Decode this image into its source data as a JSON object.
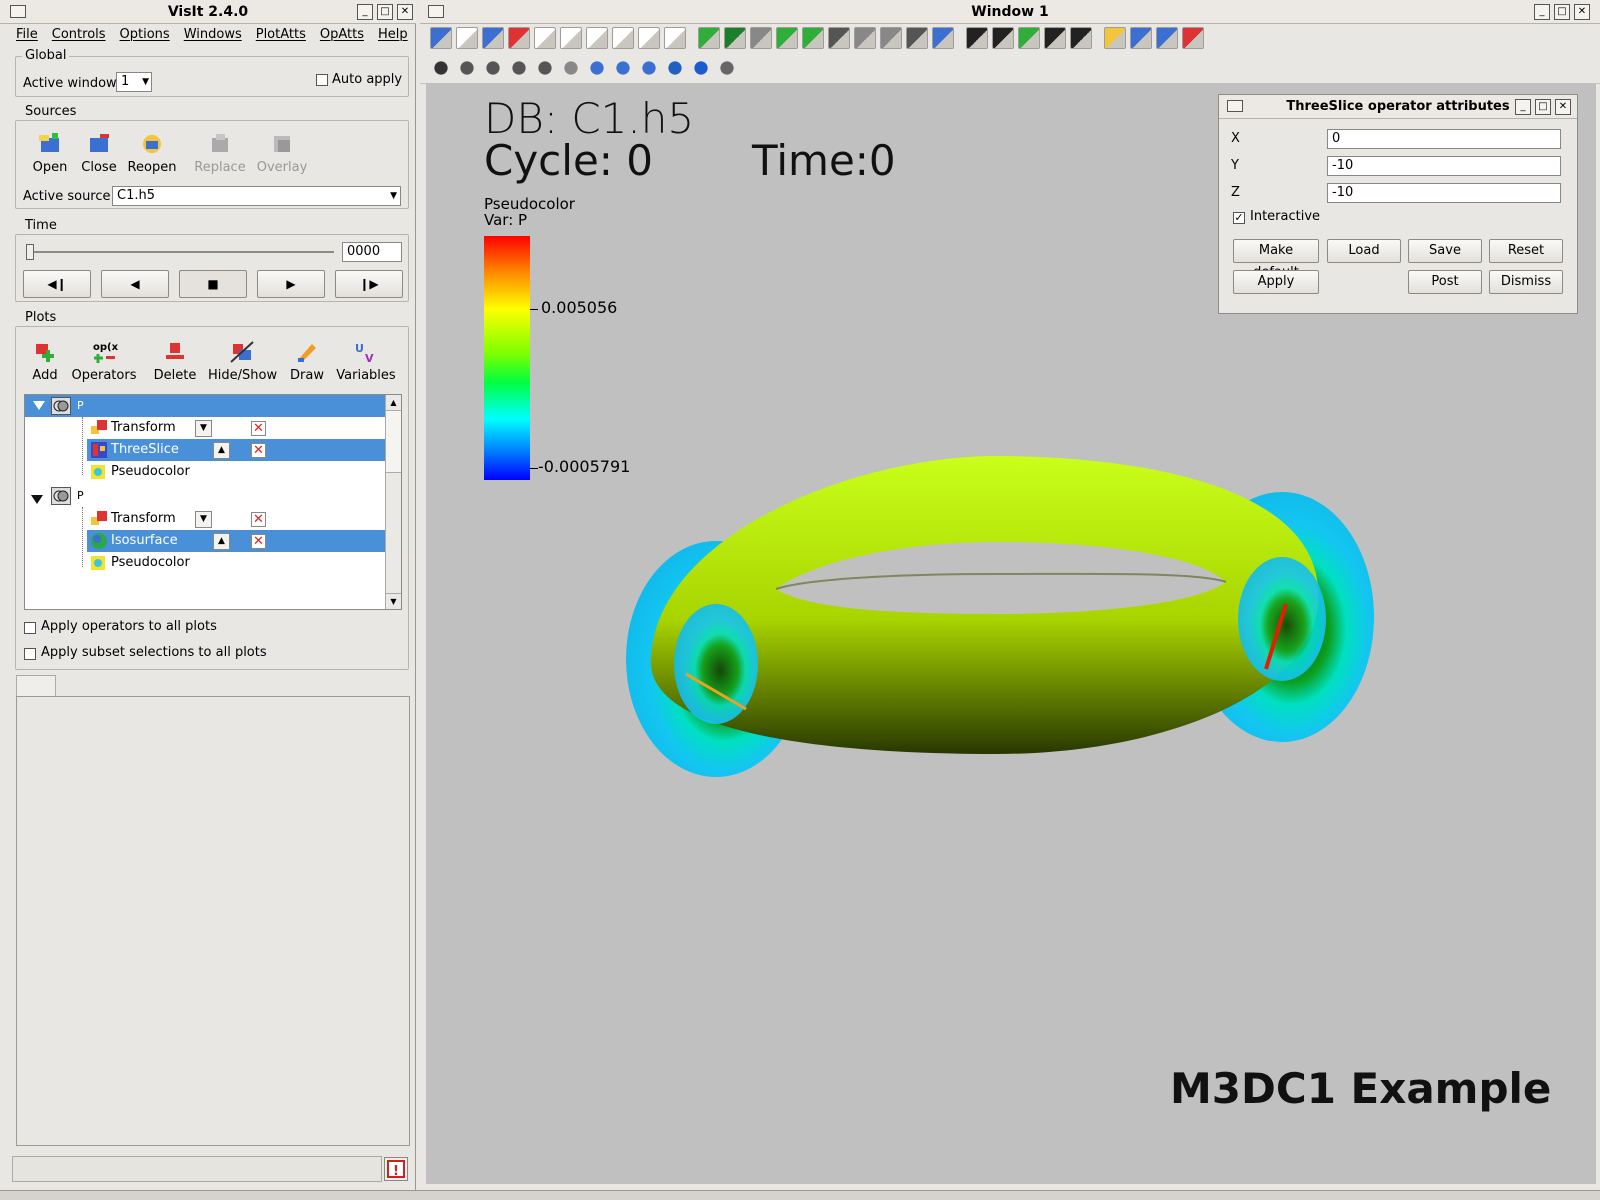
{
  "gui": {
    "title": "VisIt 2.4.0",
    "menu": [
      "File",
      "Controls",
      "Options",
      "Windows",
      "PlotAtts",
      "OpAtts",
      "Help"
    ],
    "global": {
      "title": "Global",
      "active_window_label": "Active window",
      "active_window_value": "1",
      "auto_apply_label": "Auto apply"
    },
    "sources": {
      "title": "Sources",
      "buttons": [
        "Open",
        "Close",
        "Reopen",
        "Replace",
        "Overlay"
      ],
      "active_source_label": "Active source",
      "active_source_value": "C1.h5"
    },
    "time": {
      "title": "Time",
      "frame_value": "0000"
    },
    "plots": {
      "title": "Plots",
      "buttons": [
        "Add",
        "Operators",
        "Delete",
        "Hide/Show",
        "Draw",
        "Variables"
      ],
      "tree": [
        {
          "label": "P"
        },
        {
          "label": "Transform"
        },
        {
          "label": "ThreeSlice"
        },
        {
          "label": "Pseudocolor"
        },
        {
          "label": "P"
        },
        {
          "label": "Transform"
        },
        {
          "label": "Isosurface"
        },
        {
          "label": "Pseudocolor"
        }
      ],
      "apply_ops_label": "Apply operators to all plots",
      "apply_subset_label": "Apply subset selections to all plots"
    }
  },
  "viewer": {
    "title": "Window 1",
    "db_text": "DB: C1.h5",
    "cycle_text": "Cycle: 0",
    "time_text": "Time:0",
    "legend_title": "Pseudocolor",
    "legend_var": "Var: P",
    "legend_max": "0.005056",
    "legend_min": "-0.0005791",
    "caption": "M3DC1 Example"
  },
  "threeslice": {
    "title": "ThreeSlice operator attributes",
    "x_label": "X",
    "x_value": "0",
    "y_label": "Y",
    "y_value": "-10",
    "z_label": "Z",
    "z_value": "-10",
    "interactive_label": "Interactive",
    "buttons": {
      "make_default": "Make default",
      "load": "Load",
      "save": "Save",
      "reset": "Reset",
      "apply": "Apply",
      "post": "Post",
      "dismiss": "Dismiss"
    }
  }
}
